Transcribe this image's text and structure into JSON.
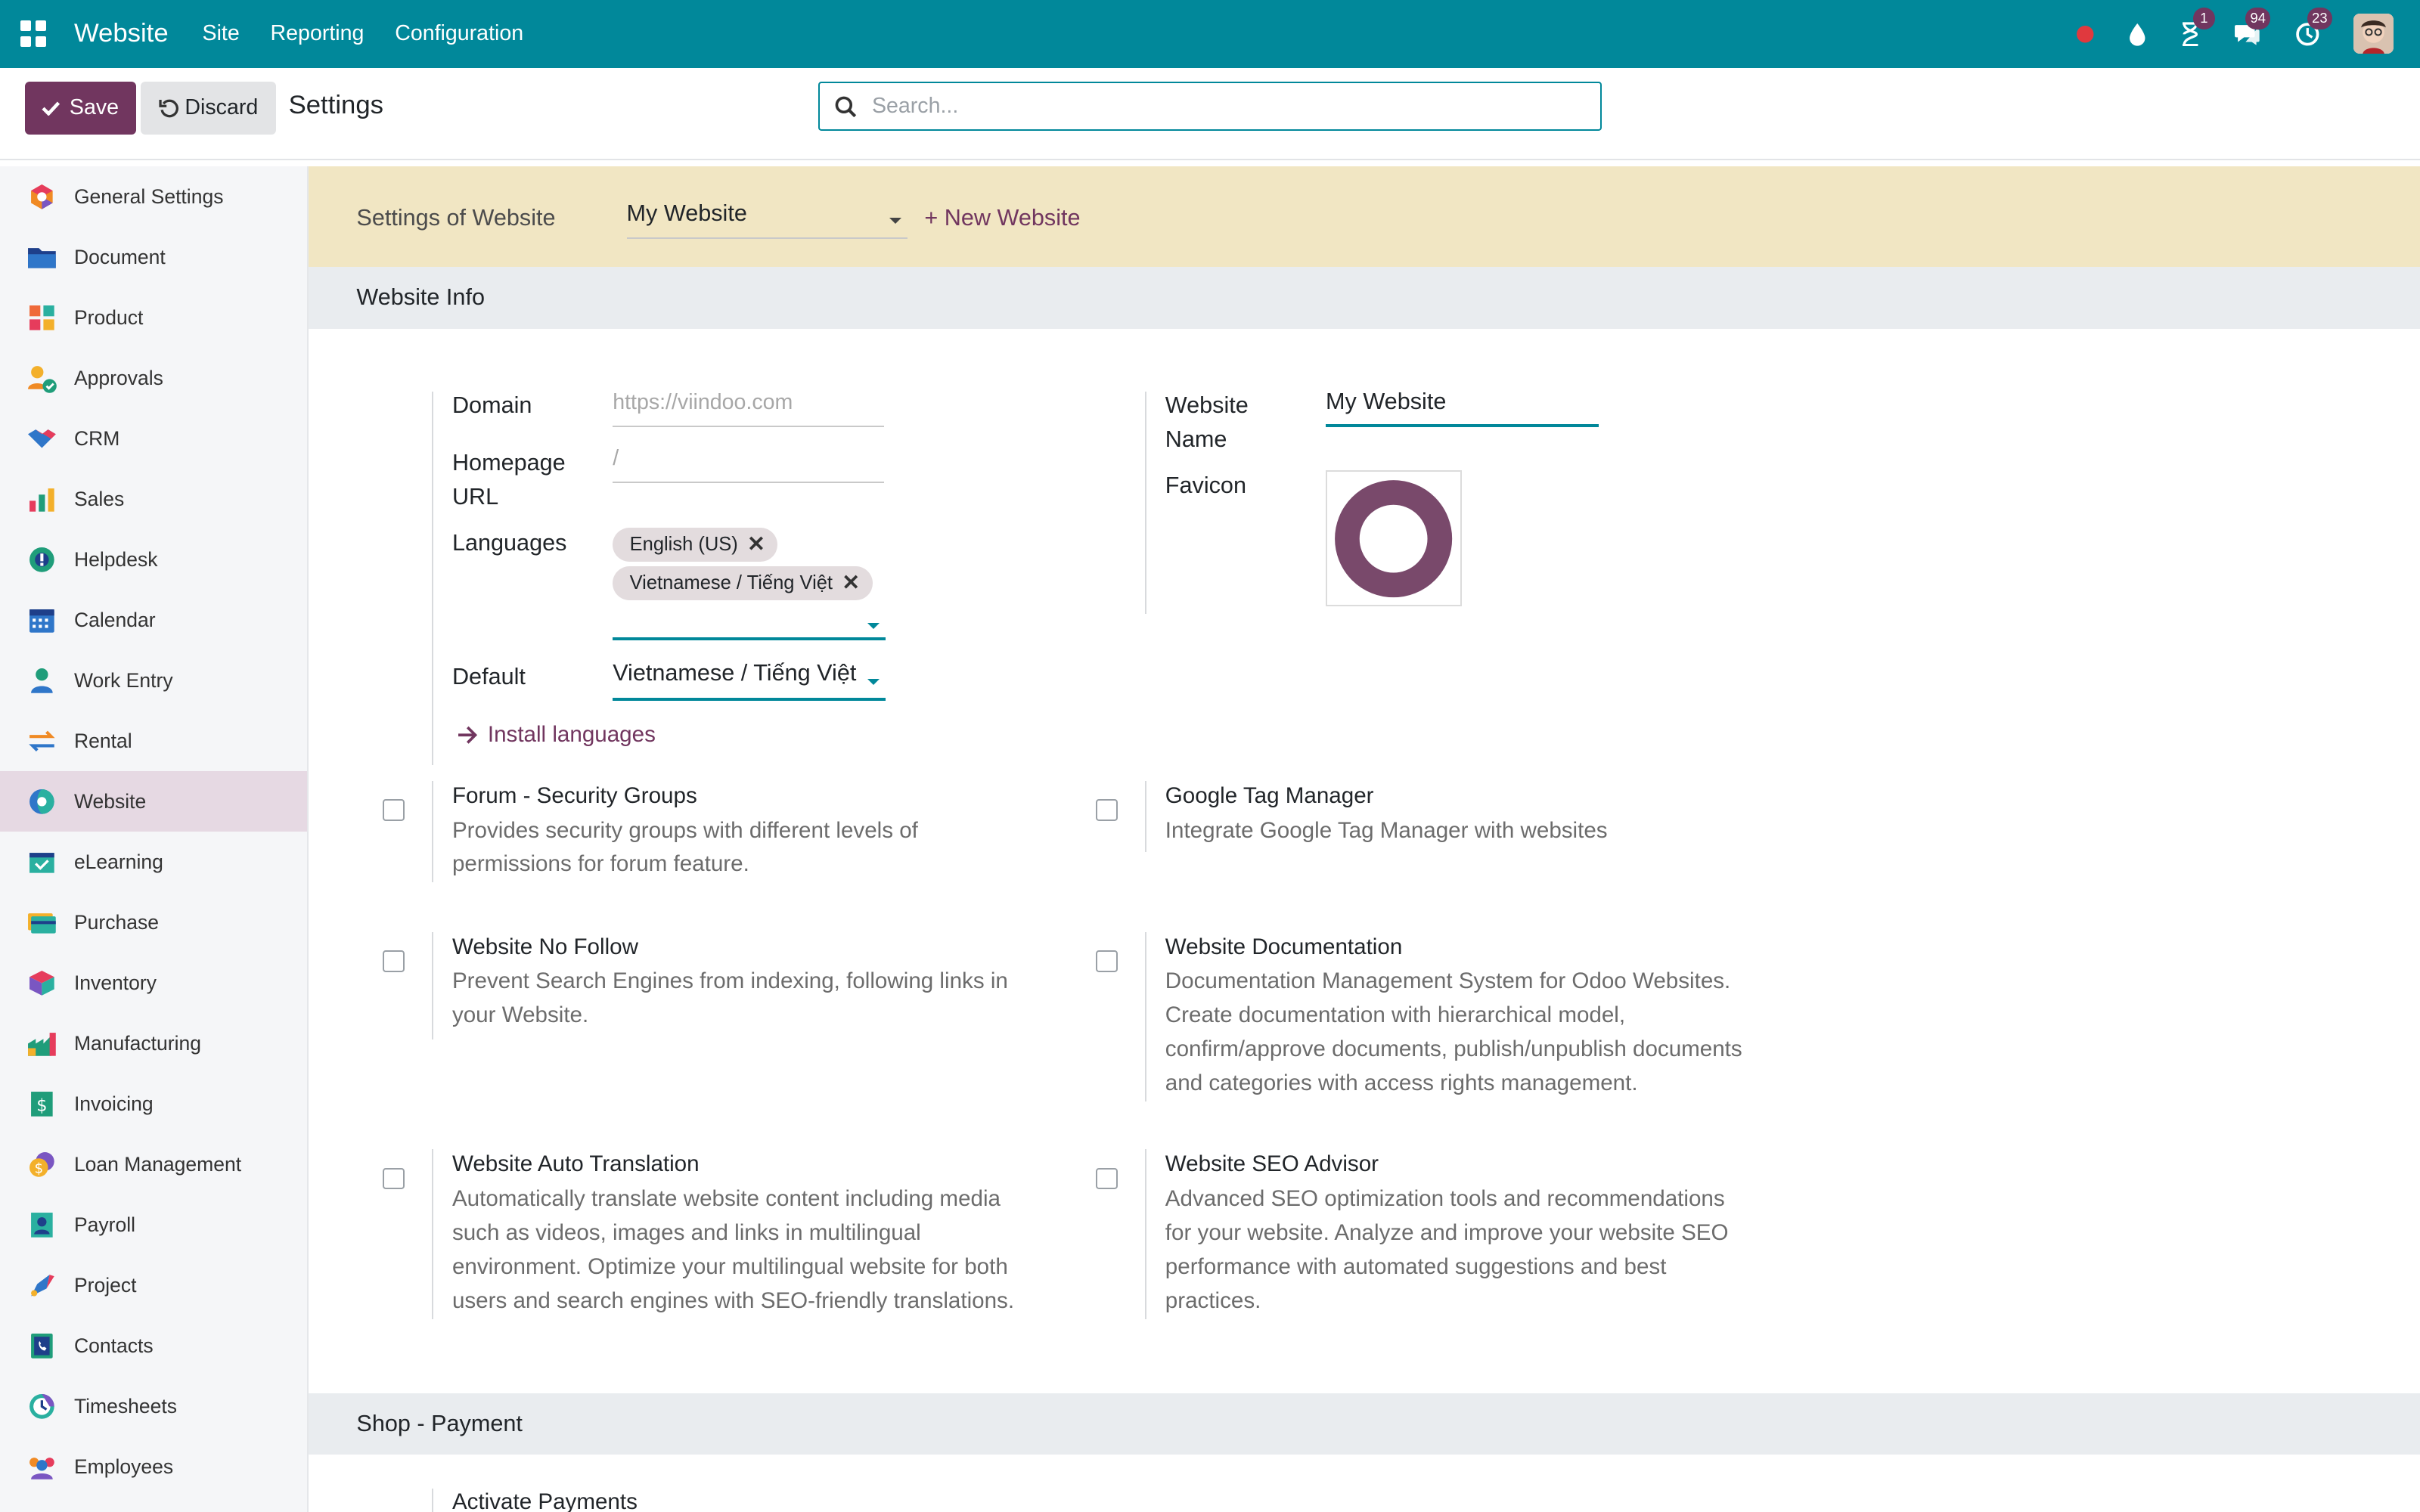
{
  "topbar": {
    "brand": "Website",
    "menus": [
      "Site",
      "Reporting",
      "Configuration"
    ],
    "badges": {
      "activities": "1",
      "messages": "94",
      "timer": "23"
    },
    "color": "#01889a"
  },
  "control": {
    "save_label": "Save",
    "discard_label": "Discard",
    "title": "Settings",
    "search_placeholder": "Search..."
  },
  "sidebar": {
    "items": [
      {
        "label": "General Settings",
        "icon": "general-settings-icon"
      },
      {
        "label": "Document",
        "icon": "folder-icon"
      },
      {
        "label": "Product",
        "icon": "product-icon"
      },
      {
        "label": "Approvals",
        "icon": "approvals-icon"
      },
      {
        "label": "CRM",
        "icon": "crm-icon"
      },
      {
        "label": "Sales",
        "icon": "sales-icon"
      },
      {
        "label": "Helpdesk",
        "icon": "helpdesk-icon"
      },
      {
        "label": "Calendar",
        "icon": "calendar-icon"
      },
      {
        "label": "Work Entry",
        "icon": "work-entry-icon"
      },
      {
        "label": "Rental",
        "icon": "rental-icon"
      },
      {
        "label": "Website",
        "icon": "website-icon"
      },
      {
        "label": "eLearning",
        "icon": "elearning-icon"
      },
      {
        "label": "Purchase",
        "icon": "purchase-icon"
      },
      {
        "label": "Inventory",
        "icon": "inventory-icon"
      },
      {
        "label": "Manufacturing",
        "icon": "manufacturing-icon"
      },
      {
        "label": "Invoicing",
        "icon": "invoicing-icon"
      },
      {
        "label": "Loan Management",
        "icon": "loan-icon"
      },
      {
        "label": "Payroll",
        "icon": "payroll-icon"
      },
      {
        "label": "Project",
        "icon": "project-icon"
      },
      {
        "label": "Contacts",
        "icon": "contacts-icon"
      },
      {
        "label": "Timesheets",
        "icon": "timesheets-icon"
      },
      {
        "label": "Employees",
        "icon": "employees-icon"
      }
    ],
    "active": "Website"
  },
  "website_bar": {
    "label": "Settings of Website",
    "selected": "My Website",
    "new_label": "+ New Website"
  },
  "website_info": {
    "header": "Website Info",
    "domain_label": "Domain",
    "domain_placeholder": "https://viindoo.com",
    "homepage_label_1": "Homepage",
    "homepage_label_2": "URL",
    "homepage_placeholder": "/",
    "languages_label": "Languages",
    "languages": [
      "English (US)",
      "Vietnamese / Tiếng Việt"
    ],
    "default_label": "Default",
    "default_value": "Vietnamese / Tiếng Việt",
    "install_languages": "Install languages",
    "website_name_label_1": "Website",
    "website_name_label_2": "Name",
    "website_name_value": "My Website",
    "favicon_label": "Favicon"
  },
  "options": {
    "forum_title": "Forum - Security Groups",
    "forum_desc_1": "Provides security groups with different levels of",
    "forum_desc_2": "permissions for forum feature.",
    "gtm_title": "Google Tag Manager",
    "gtm_desc_1": "Integrate Google Tag Manager with websites",
    "nofollow_title": "Website No Follow",
    "nofollow_desc_1": "Prevent Search Engines from indexing, following links in",
    "nofollow_desc_2": "your Website.",
    "doc_title": "Website Documentation",
    "doc_desc_1": "Documentation Management System for Odoo Websites.",
    "doc_desc_2": "Create documentation with hierarchical model,",
    "doc_desc_3": "confirm/approve documents, publish/unpublish documents",
    "doc_desc_4": "and categories with access rights management.",
    "trans_title": "Website Auto Translation",
    "trans_desc_1": "Automatically translate website content including media",
    "trans_desc_2": "such as videos, images and links in multilingual",
    "trans_desc_3": "environment. Optimize your multilingual website for both",
    "trans_desc_4": "users and search engines with SEO-friendly translations.",
    "seo_title": "Website SEO Advisor",
    "seo_desc_1": "Advanced SEO optimization tools and recommendations",
    "seo_desc_2": "for your website. Analyze and improve your website SEO",
    "seo_desc_3": "performance with automated suggestions and best",
    "seo_desc_4": "practices."
  },
  "shop_payment": {
    "header": "Shop - Payment",
    "activate_payments": "Activate Payments"
  }
}
